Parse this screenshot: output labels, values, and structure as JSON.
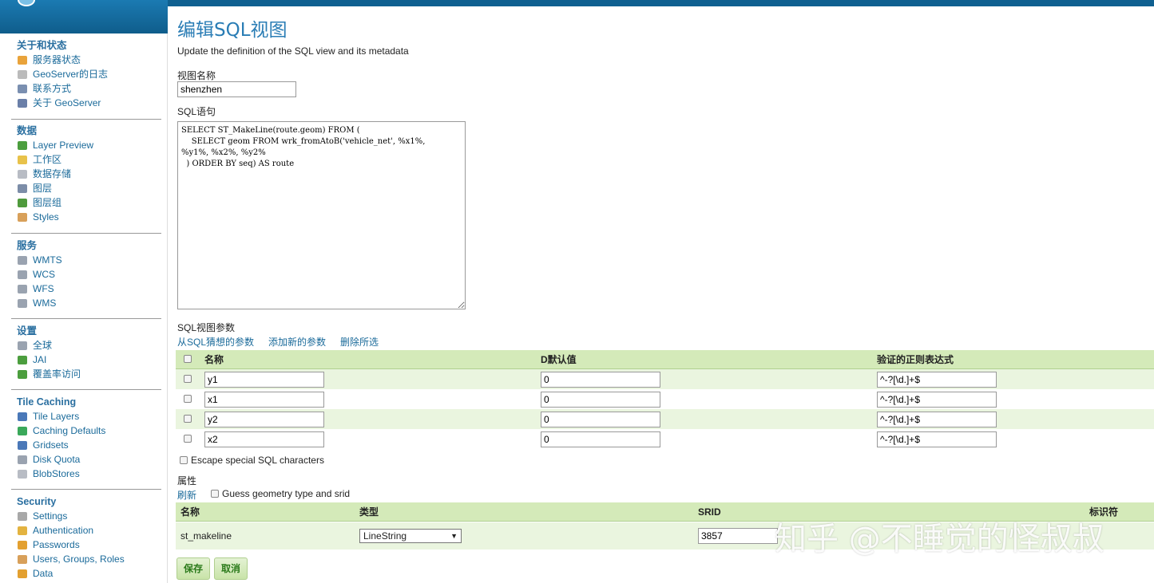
{
  "sidebar": {
    "sections": [
      {
        "title": "关于和状态",
        "items": [
          {
            "label": "服务器状态",
            "icon": "server-status-icon",
            "color": "#e9a33b"
          },
          {
            "label": "GeoServer的日志",
            "icon": "document-icon",
            "color": "#bbbbbb"
          },
          {
            "label": "联系方式",
            "icon": "contact-card-icon",
            "color": "#7a8fb0"
          },
          {
            "label": "关于 GeoServer",
            "icon": "info-icon",
            "color": "#6a7fa8"
          }
        ]
      },
      {
        "title": "数据",
        "items": [
          {
            "label": "Layer Preview",
            "icon": "map-preview-icon",
            "color": "#4c9e3e"
          },
          {
            "label": "工作区",
            "icon": "folder-icon",
            "color": "#e8c24a"
          },
          {
            "label": "数据存储",
            "icon": "database-icon",
            "color": "#b8bcc4"
          },
          {
            "label": "图层",
            "icon": "layer-icon",
            "color": "#7c8da8"
          },
          {
            "label": "图层组",
            "icon": "layer-group-icon",
            "color": "#4f9a3c"
          },
          {
            "label": "Styles",
            "icon": "palette-icon",
            "color": "#d8a05a"
          }
        ]
      },
      {
        "title": "服务",
        "items": [
          {
            "label": "WMTS",
            "icon": "service-icon",
            "color": "#9aa3b0"
          },
          {
            "label": "WCS",
            "icon": "service-icon",
            "color": "#9aa3b0"
          },
          {
            "label": "WFS",
            "icon": "service-icon",
            "color": "#9aa3b0"
          },
          {
            "label": "WMS",
            "icon": "service-icon",
            "color": "#9aa3b0"
          }
        ]
      },
      {
        "title": "设置",
        "items": [
          {
            "label": "全球",
            "icon": "settings-icon",
            "color": "#9aa3b0"
          },
          {
            "label": "JAI",
            "icon": "image-icon",
            "color": "#4c9e3e"
          },
          {
            "label": "覆盖率访问",
            "icon": "coverage-icon",
            "color": "#4c9e3e"
          }
        ]
      },
      {
        "title": "Tile Caching",
        "items": [
          {
            "label": "Tile Layers",
            "icon": "tile-layers-icon",
            "color": "#4a78b8"
          },
          {
            "label": "Caching Defaults",
            "icon": "globe-icon",
            "color": "#3aa85a"
          },
          {
            "label": "Gridsets",
            "icon": "grid-icon",
            "color": "#4a78b8"
          },
          {
            "label": "Disk Quota",
            "icon": "disk-icon",
            "color": "#9aa3b0"
          },
          {
            "label": "BlobStores",
            "icon": "blobstore-icon",
            "color": "#b8bcc4"
          }
        ]
      },
      {
        "title": "Security",
        "items": [
          {
            "label": "Settings",
            "icon": "key-icon",
            "color": "#a8a8a8"
          },
          {
            "label": "Authentication",
            "icon": "shield-icon",
            "color": "#e3b340"
          },
          {
            "label": "Passwords",
            "icon": "lock-icon",
            "color": "#e3a030"
          },
          {
            "label": "Users, Groups, Roles",
            "icon": "users-icon",
            "color": "#d8a05a"
          },
          {
            "label": "Data",
            "icon": "data-lock-icon",
            "color": "#e3a030"
          }
        ]
      }
    ]
  },
  "page": {
    "title": "编辑SQL视图",
    "description": "Update the definition of the SQL view and its metadata",
    "view_name_label": "视图名称",
    "view_name_value": "shenzhen",
    "sql_label": "SQL语句",
    "sql_value": "SELECT ST_MakeLine(route.geom) FROM (\n    SELECT geom FROM wrk_fromAtoB('vehicle_net', %x1%,\n%y1%, %x2%, %y2%\n  ) ORDER BY seq) AS route"
  },
  "params": {
    "label": "SQL视图参数",
    "links": [
      "从SQL猜想的参数",
      "添加新的参数",
      "删除所选"
    ],
    "headers": [
      "名称",
      "D默认值",
      "验证的正则表达式"
    ],
    "rows": [
      {
        "name": "y1",
        "default": "0",
        "regex": "^-?[\\d.]+$"
      },
      {
        "name": "x1",
        "default": "0",
        "regex": "^-?[\\d.]+$"
      },
      {
        "name": "y2",
        "default": "0",
        "regex": "^-?[\\d.]+$"
      },
      {
        "name": "x2",
        "default": "0",
        "regex": "^-?[\\d.]+$"
      }
    ],
    "escape_label": "Escape special SQL characters"
  },
  "attributes": {
    "label": "属性",
    "refresh": "刷新",
    "guess_label": "Guess geometry type and srid",
    "headers": [
      "名称",
      "类型",
      "SRID",
      "标识符"
    ],
    "row": {
      "name": "st_makeline",
      "type": "LineString",
      "srid": "3857"
    }
  },
  "buttons": {
    "save": "保存",
    "cancel": "取消"
  },
  "watermark": "知乎 @不睡觉的怪叔叔"
}
